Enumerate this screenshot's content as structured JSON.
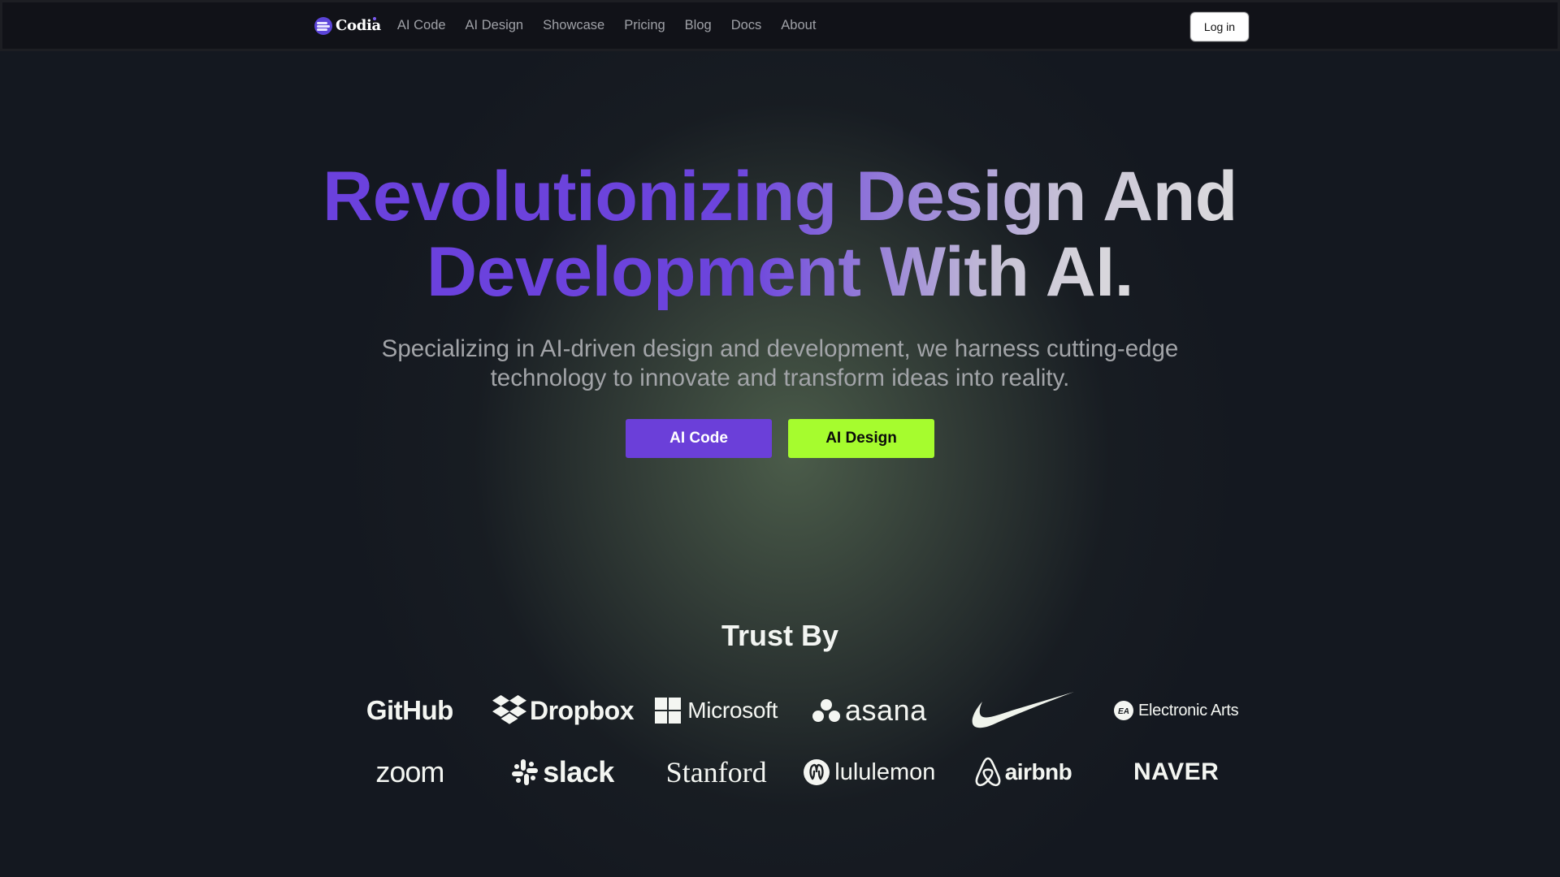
{
  "nav": {
    "brand": "Codia",
    "links": [
      "AI Code",
      "AI Design",
      "Showcase",
      "Pricing",
      "Blog",
      "Docs",
      "About"
    ],
    "login_label": "Log in"
  },
  "hero": {
    "title_line1": "Revolutionizing Design And",
    "title_line2": "Development With AI.",
    "subtitle_line1": "Specializing in AI-driven design and development, we harness cutting-edge",
    "subtitle_line2": "technology to innovate and transform ideas into reality.",
    "buttons": {
      "ai_code": "AI Code",
      "ai_design": "AI Design"
    }
  },
  "trust": {
    "title": "Trust By",
    "row1": [
      {
        "name": "GitHub",
        "icon": "github-wordmark"
      },
      {
        "name": "Dropbox",
        "icon": "dropbox-icon"
      },
      {
        "name": "Microsoft",
        "icon": "microsoft-icon"
      },
      {
        "name": "asana",
        "icon": "asana-icon"
      },
      {
        "name": "Nike",
        "icon": "nike-swoosh-icon"
      },
      {
        "name": "Electronic Arts",
        "icon": "ea-icon"
      }
    ],
    "row2": [
      {
        "name": "zoom",
        "icon": "zoom-wordmark"
      },
      {
        "name": "slack",
        "icon": "slack-icon"
      },
      {
        "name": "Stanford",
        "icon": "stanford-wordmark"
      },
      {
        "name": "lululemon",
        "icon": "lululemon-icon"
      },
      {
        "name": "airbnb",
        "icon": "airbnb-icon"
      },
      {
        "name": "NAVER",
        "icon": "naver-wordmark"
      }
    ]
  },
  "colors": {
    "page_bg": "#141820",
    "nav_bg": "#111218",
    "primary_purple": "#6b3fd9",
    "accent_green": "#a6fc2e",
    "glow": "#4e604c"
  }
}
